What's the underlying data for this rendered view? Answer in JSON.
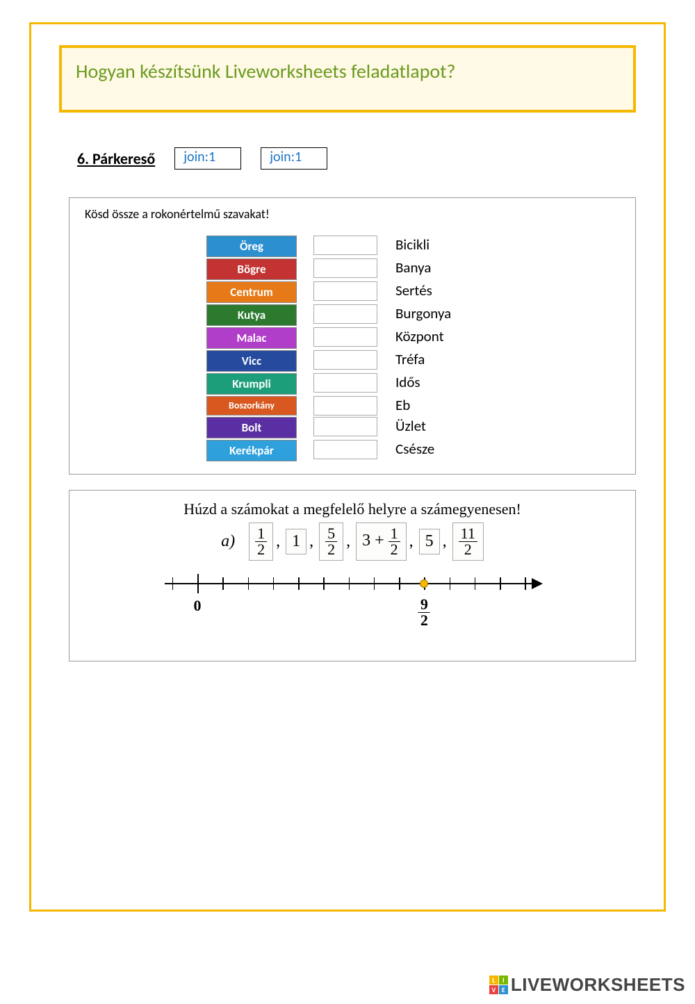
{
  "page_title": "Hogyan készítsünk Liveworksheets feladatlapot?",
  "section": {
    "heading": "6. Párkereső",
    "join_label_1": "join:1",
    "join_label_2": "join:1"
  },
  "exercise1": {
    "instruction": "Kösd össze a rokonértelmű szavakat!",
    "left": [
      "Öreg",
      "Bögre",
      "Centrum",
      "Kutya",
      "Malac",
      "Vicc",
      "Krumpli",
      "Boszorkány",
      "Bolt",
      "Kerékpár"
    ],
    "right": [
      "Bicikli",
      "Banya",
      "Sertés",
      "Burgonya",
      "Központ",
      "Tréfa",
      "Idős",
      "Eb",
      "Üzlet",
      "Csésze"
    ]
  },
  "exercise2": {
    "instruction": "Húzd a számokat a megfelelő helyre a számegyenesen!",
    "label": "a)",
    "items": [
      {
        "num": "1",
        "den": "2",
        "plain": null,
        "expr": null
      },
      {
        "num": null,
        "den": null,
        "plain": "1",
        "expr": null
      },
      {
        "num": "5",
        "den": "2",
        "plain": null,
        "expr": null
      },
      {
        "num": null,
        "den": null,
        "plain": null,
        "expr": {
          "whole": "3",
          "num": "1",
          "den": "2"
        }
      },
      {
        "num": null,
        "den": null,
        "plain": "5",
        "expr": null
      },
      {
        "num": "11",
        "den": "2",
        "plain": null,
        "expr": null
      }
    ],
    "numberline": {
      "zero_label": "0",
      "marker": {
        "pos_fraction": 0.692,
        "num": "9",
        "den": "2"
      }
    }
  },
  "watermark": {
    "l": "L",
    "i": "I",
    "v": "V",
    "e": "E",
    "text": "LIVEWORKSHEETS"
  }
}
